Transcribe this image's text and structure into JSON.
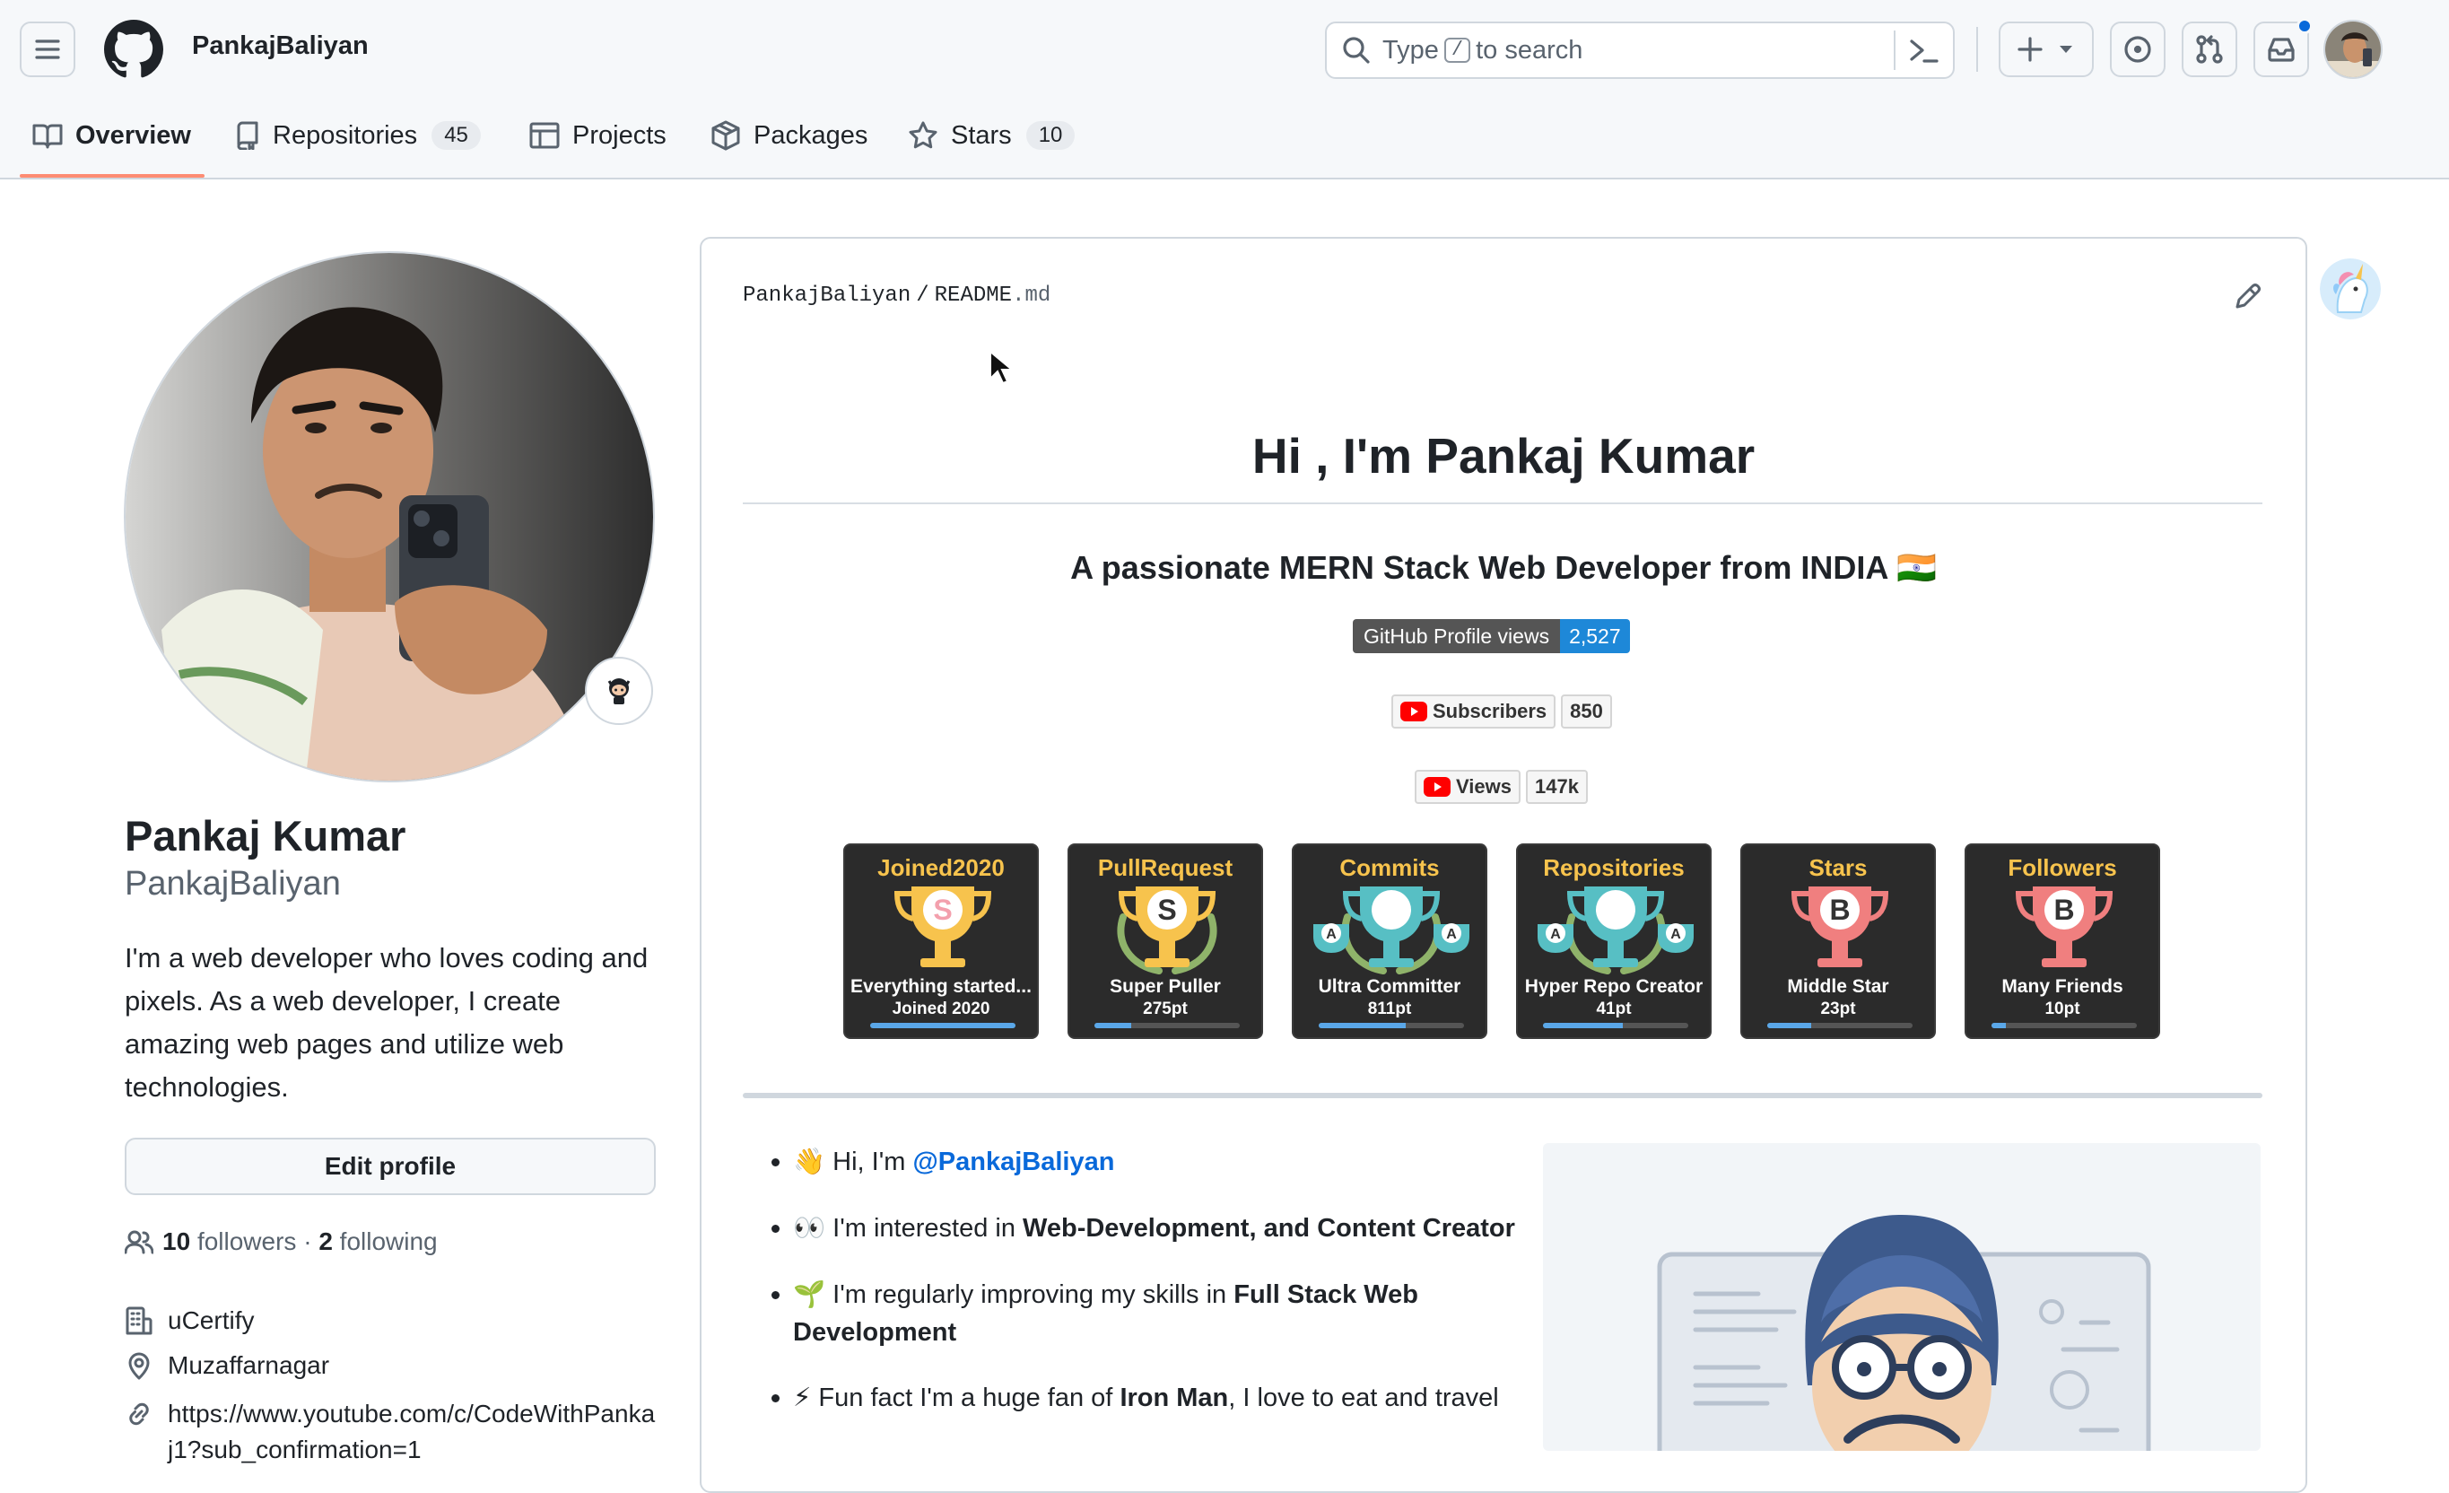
{
  "header": {
    "username": "PankajBaliyan",
    "search": {
      "prefix": "Type",
      "key": "/",
      "suffix": "to search"
    },
    "notification_dot_color": "#0969da"
  },
  "nav": {
    "tabs": [
      {
        "label": "Overview",
        "icon": "book-icon",
        "active": true
      },
      {
        "label": "Repositories",
        "icon": "repo-icon",
        "count": "45"
      },
      {
        "label": "Projects",
        "icon": "table-icon"
      },
      {
        "label": "Packages",
        "icon": "package-icon"
      },
      {
        "label": "Stars",
        "icon": "star-icon",
        "count": "10"
      }
    ],
    "active_underline_color": "#fd8c73"
  },
  "profile": {
    "full_name": "Pankaj Kumar",
    "login": "PankajBaliyan",
    "bio": "I'm a web developer who loves coding and pixels. As a web developer, I create amazing web pages and utilize web technologies.",
    "edit_profile": "Edit profile",
    "followers_count": "10",
    "followers_label": "followers",
    "separator": "·",
    "following_count": "2",
    "following_label": "following",
    "company": "uCertify",
    "location": "Muzaffarnagar",
    "website": "https://www.youtube.com/c/CodeWithPankaj1?sub_confirmation=1"
  },
  "readme": {
    "owner": "PankajBaliyan",
    "slash": "/",
    "file_name": "README",
    "file_ext": ".md",
    "heading": "Hi , I'm Pankaj Kumar",
    "subheading": "A passionate MERN Stack Web Developer from INDIA 🇮🇳",
    "badges": {
      "views_label": "GitHub Profile views",
      "views_value": "2,527",
      "subscribers_label": "Subscribers",
      "subscribers_value": "850",
      "yt_views_label": "Views",
      "yt_views_value": "147k"
    },
    "trophies": [
      {
        "title": "Joined2020",
        "rank": "S",
        "name": "Everything started...",
        "points": "Joined 2020",
        "progress": 1.0
      },
      {
        "title": "PullRequest",
        "rank": "S",
        "name": "Super Puller",
        "points": "275pt",
        "progress": 0.25
      },
      {
        "title": "Commits",
        "rank": "A",
        "name": "Ultra Committer",
        "points": "811pt",
        "progress": 0.6
      },
      {
        "title": "Repositories",
        "rank": "A",
        "name": "Hyper Repo Creator",
        "points": "41pt",
        "progress": 0.55
      },
      {
        "title": "Stars",
        "rank": "B",
        "name": "Middle Star",
        "points": "23pt",
        "progress": 0.3
      },
      {
        "title": "Followers",
        "rank": "B",
        "name": "Many Friends",
        "points": "10pt",
        "progress": 0.1
      }
    ],
    "list": {
      "item1_prefix": "👋 Hi, I'm ",
      "item1_link": "@PankajBaliyan",
      "item2_prefix": "👀 I'm interested in ",
      "item2_bold": "Web-Development, and Content Creator",
      "item3_prefix": "🌱 I'm regularly improving my skills in ",
      "item3_bold": "Full Stack Web Development",
      "item4_prefix": "⚡ Fun fact I'm a huge fan of ",
      "item4_bold": "Iron Man",
      "item4_suffix": ", I love to eat and travel"
    }
  }
}
